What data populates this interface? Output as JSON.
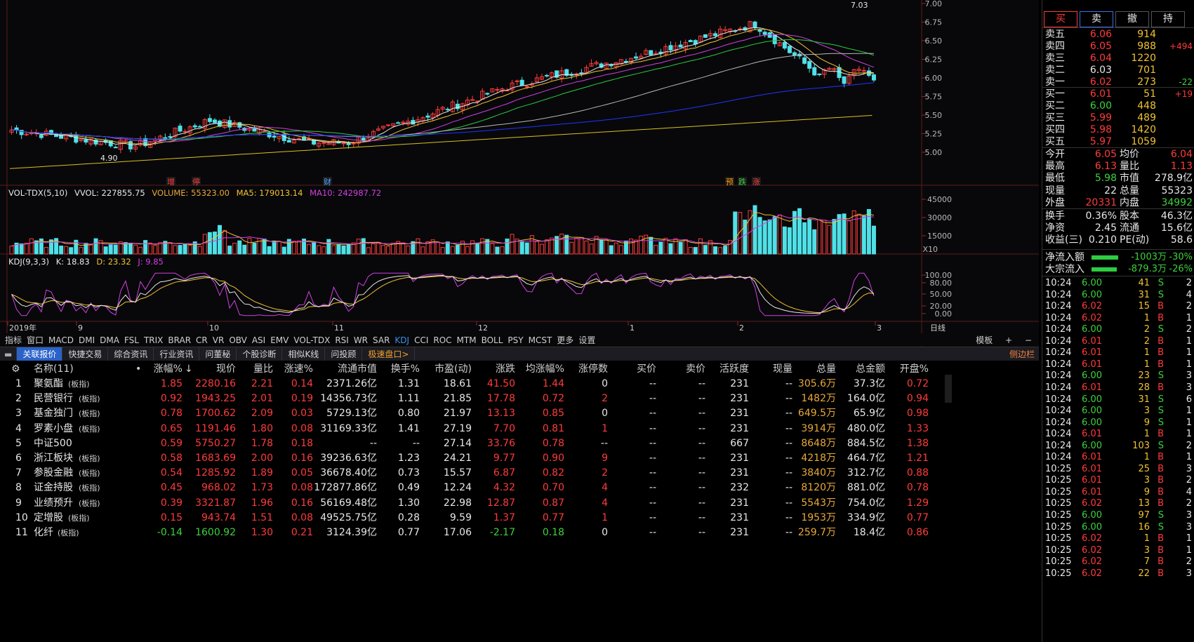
{
  "chart": {
    "price_axis": [
      "7.00",
      "6.75",
      "6.50",
      "6.25",
      "6.00",
      "5.75",
      "5.50",
      "5.25",
      "5.00"
    ],
    "high_label": "7.03",
    "low_label": "4.90",
    "event_markers": [
      {
        "text": "增",
        "color": "#ff3b3b"
      },
      {
        "text": "停",
        "color": "#ff3b3b"
      },
      {
        "text": "财",
        "color": "#4fa3ff"
      },
      {
        "text": "预",
        "color": "#ff9900"
      },
      {
        "text": "跌",
        "color": "#3ed13e"
      },
      {
        "text": "涨",
        "color": "#ff3b3b"
      }
    ],
    "vol_header": {
      "name": "VOL-TDX(5,10)",
      "vvol": "VVOL: 227855.75",
      "volume": "VOLUME: 55323.00",
      "ma5": "MA5: 179013.14",
      "ma10": "MA10: 242987.72"
    },
    "vol_axis": [
      "45000",
      "30000",
      "15000"
    ],
    "vol_unit": "X10",
    "kdj_header": {
      "name": "KDJ(9,3,3)",
      "k": "K: 18.83",
      "d": "D: 23.32",
      "j": "J: 9.85"
    },
    "kdj_axis": [
      "100.00",
      "80.00",
      "50.00",
      "20.00",
      "0.00"
    ],
    "time_axis": [
      "2019年",
      "9",
      "10",
      "11",
      "12",
      "1",
      "2",
      "3"
    ],
    "time_axis_right": "日线"
  },
  "indicator_tabs": [
    "指标",
    "窗口",
    "MACD",
    "DMI",
    "DMA",
    "FSL",
    "TRIX",
    "BRAR",
    "CR",
    "VR",
    "OBV",
    "ASI",
    "EMV",
    "VOL-TDX",
    "RSI",
    "WR",
    "SAR",
    "KDJ",
    "CCI",
    "ROC",
    "MTM",
    "BOLL",
    "PSY",
    "MCST",
    "更多",
    "设置"
  ],
  "indicator_active": "KDJ",
  "indicator_right": [
    "模板",
    "+",
    "−"
  ],
  "bottom_tabs": [
    "关联报价",
    "快捷交易",
    "综合资讯",
    "行业资讯",
    "问董秘",
    "个股诊断",
    "相似K线",
    "问投顾",
    "极速盘口>"
  ],
  "side_toggle": "侧边栏",
  "table": {
    "headers": [
      "名称(11)",
      "涨幅%",
      "现价",
      "量比",
      "涨速%",
      "流通市值",
      "换手%",
      "市盈(动)",
      "涨跌",
      "均涨幅%",
      "涨停数",
      "买价",
      "卖价",
      "活跃度",
      "现量",
      "总量",
      "总金额",
      "开盘%"
    ],
    "sort_mark": "↓",
    "rows": [
      [
        "1",
        "聚氨酯",
        "(板指)",
        "1.85",
        "2280.16",
        "2.21",
        "0.14",
        "2371.26亿",
        "1.31",
        "18.61",
        "41.50",
        "1.44",
        "0",
        "--",
        "--",
        "231",
        "--",
        "305.6万",
        "37.3亿",
        "0.72"
      ],
      [
        "2",
        "民营银行",
        "(板指)",
        "0.92",
        "1943.25",
        "2.01",
        "0.19",
        "14356.73亿",
        "1.11",
        "21.85",
        "17.78",
        "0.72",
        "2",
        "--",
        "--",
        "231",
        "--",
        "1482万",
        "164.0亿",
        "0.94"
      ],
      [
        "3",
        "基金独门",
        "(板指)",
        "0.78",
        "1700.62",
        "2.09",
        "0.03",
        "5729.13亿",
        "0.80",
        "21.97",
        "13.13",
        "0.85",
        "0",
        "--",
        "--",
        "231",
        "--",
        "649.5万",
        "65.9亿",
        "0.98"
      ],
      [
        "4",
        "罗素小盘",
        "(板指)",
        "0.65",
        "1191.46",
        "1.80",
        "0.08",
        "31169.33亿",
        "1.41",
        "27.19",
        "7.70",
        "0.81",
        "1",
        "--",
        "--",
        "231",
        "--",
        "3914万",
        "480.0亿",
        "1.33"
      ],
      [
        "5",
        "中证500",
        "",
        "0.59",
        "5750.27",
        "1.78",
        "0.18",
        "--",
        "--",
        "27.14",
        "33.76",
        "0.78",
        "--",
        "--",
        "--",
        "667",
        "--",
        "8648万",
        "884.5亿",
        "1.38"
      ],
      [
        "6",
        "浙江板块",
        "(板指)",
        "0.58",
        "1683.69",
        "2.00",
        "0.16",
        "39236.63亿",
        "1.23",
        "24.21",
        "9.77",
        "0.90",
        "9",
        "--",
        "--",
        "231",
        "--",
        "4218万",
        "464.7亿",
        "1.21"
      ],
      [
        "7",
        "参股金融",
        "(板指)",
        "0.54",
        "1285.92",
        "1.89",
        "0.05",
        "36678.40亿",
        "0.73",
        "15.57",
        "6.87",
        "0.82",
        "2",
        "--",
        "--",
        "231",
        "--",
        "3840万",
        "312.7亿",
        "0.88"
      ],
      [
        "8",
        "证金持股",
        "(板指)",
        "0.45",
        "968.02",
        "1.73",
        "0.08",
        "172877.86亿",
        "0.49",
        "12.24",
        "4.32",
        "0.70",
        "4",
        "--",
        "--",
        "232",
        "--",
        "8120万",
        "881.0亿",
        "0.78"
      ],
      [
        "9",
        "业绩预升",
        "(板指)",
        "0.39",
        "3321.87",
        "1.96",
        "0.16",
        "56169.48亿",
        "1.30",
        "22.98",
        "12.87",
        "0.87",
        "4",
        "--",
        "--",
        "231",
        "--",
        "5543万",
        "754.0亿",
        "1.29"
      ],
      [
        "10",
        "定增股",
        "(板指)",
        "0.15",
        "943.74",
        "1.51",
        "0.08",
        "49525.75亿",
        "0.28",
        "9.59",
        "1.37",
        "0.77",
        "1",
        "--",
        "--",
        "231",
        "--",
        "1953万",
        "334.9亿",
        "0.77"
      ],
      [
        "11",
        "化纤",
        "(板指)",
        "-0.14",
        "1600.92",
        "1.30",
        "0.21",
        "3124.39亿",
        "0.77",
        "17.06",
        "-2.17",
        "0.18",
        "0",
        "--",
        "--",
        "231",
        "--",
        "259.7万",
        "18.4亿",
        "0.86"
      ]
    ]
  },
  "trade_buttons": [
    "买",
    "卖",
    "撤",
    "持"
  ],
  "order_book": {
    "sells": [
      {
        "label": "卖五",
        "price": "6.06",
        "vol": "914",
        "chg": ""
      },
      {
        "label": "卖四",
        "price": "6.05",
        "vol": "988",
        "chg": "+494"
      },
      {
        "label": "卖三",
        "price": "6.04",
        "vol": "1220",
        "chg": ""
      },
      {
        "label": "卖二",
        "price": "6.03",
        "vol": "701",
        "chg": ""
      },
      {
        "label": "卖一",
        "price": "6.02",
        "vol": "273",
        "chg": "-22"
      }
    ],
    "buys": [
      {
        "label": "买一",
        "price": "6.01",
        "vol": "51",
        "chg": "+19"
      },
      {
        "label": "买二",
        "price": "6.00",
        "vol": "448",
        "chg": ""
      },
      {
        "label": "买三",
        "price": "5.99",
        "vol": "489",
        "chg": ""
      },
      {
        "label": "买四",
        "price": "5.98",
        "vol": "1420",
        "chg": ""
      },
      {
        "label": "买五",
        "price": "5.97",
        "vol": "1059",
        "chg": ""
      }
    ]
  },
  "quote_stats": [
    [
      "今开",
      "6.05",
      "均价",
      "6.04"
    ],
    [
      "最高",
      "6.13",
      "量比",
      "1.13"
    ],
    [
      "最低",
      "5.98",
      "市值",
      "278.9亿"
    ],
    [
      "现量",
      "22",
      "总量",
      "55323"
    ],
    [
      "外盘",
      "20331",
      "内盘",
      "34992"
    ],
    [
      "换手",
      "0.36%",
      "股本",
      "46.3亿"
    ],
    [
      "净资",
      "2.45",
      "流通",
      "15.6亿"
    ],
    [
      "收益(三)",
      "0.210",
      "PE(动)",
      "58.6"
    ]
  ],
  "flow": [
    {
      "label": "净流入额",
      "value": "-1003万",
      "pct": "-30%",
      "fill": 0.75
    },
    {
      "label": "大宗流入",
      "value": "-879.3万",
      "pct": "-26%",
      "fill": 0.72
    }
  ],
  "ticks": [
    [
      "10:24",
      "6.00",
      "41",
      "S",
      "2"
    ],
    [
      "10:24",
      "6.00",
      "31",
      "S",
      "4"
    ],
    [
      "10:24",
      "6.02",
      "15",
      "B",
      "2"
    ],
    [
      "10:24",
      "6.02",
      "1",
      "B",
      "1"
    ],
    [
      "10:24",
      "6.00",
      "2",
      "S",
      "2"
    ],
    [
      "10:24",
      "6.01",
      "2",
      "B",
      "1"
    ],
    [
      "10:24",
      "6.01",
      "1",
      "B",
      "1"
    ],
    [
      "10:24",
      "6.01",
      "1",
      "B",
      "1"
    ],
    [
      "10:24",
      "6.00",
      "23",
      "S",
      "3"
    ],
    [
      "10:24",
      "6.01",
      "28",
      "B",
      "3"
    ],
    [
      "10:24",
      "6.00",
      "31",
      "S",
      "6"
    ],
    [
      "10:24",
      "6.00",
      "3",
      "S",
      "1"
    ],
    [
      "10:24",
      "6.00",
      "9",
      "S",
      "1"
    ],
    [
      "10:24",
      "6.01",
      "1",
      "B",
      "1"
    ],
    [
      "10:24",
      "6.00",
      "103",
      "S",
      "2"
    ],
    [
      "10:24",
      "6.01",
      "1",
      "B",
      "1"
    ],
    [
      "10:25",
      "6.01",
      "25",
      "B",
      "3"
    ],
    [
      "10:25",
      "6.01",
      "3",
      "B",
      "2"
    ],
    [
      "10:25",
      "6.01",
      "9",
      "B",
      "4"
    ],
    [
      "10:25",
      "6.02",
      "13",
      "B",
      "2"
    ],
    [
      "10:25",
      "6.00",
      "97",
      "S",
      "3"
    ],
    [
      "10:25",
      "6.00",
      "16",
      "S",
      "3"
    ],
    [
      "10:25",
      "6.02",
      "1",
      "B",
      "1"
    ],
    [
      "10:25",
      "6.02",
      "3",
      "B",
      "1"
    ],
    [
      "10:25",
      "6.02",
      "7",
      "B",
      "2"
    ],
    [
      "10:25",
      "6.02",
      "22",
      "B",
      "3"
    ]
  ],
  "colors": {
    "up": "#ff3b3b",
    "down": "#4fe1e8",
    "accent": "#2a62c9"
  }
}
